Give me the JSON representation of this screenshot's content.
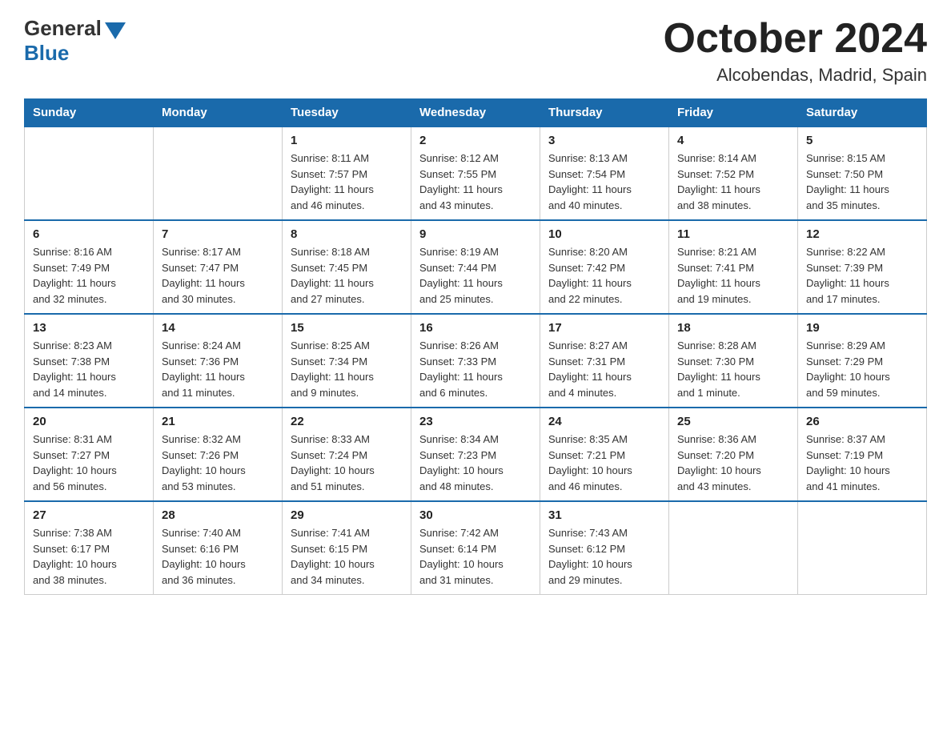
{
  "header": {
    "logo": {
      "general": "General",
      "blue": "Blue"
    },
    "title": "October 2024",
    "location": "Alcobendas, Madrid, Spain"
  },
  "columns": [
    "Sunday",
    "Monday",
    "Tuesday",
    "Wednesday",
    "Thursday",
    "Friday",
    "Saturday"
  ],
  "weeks": [
    [
      {
        "day": "",
        "info": ""
      },
      {
        "day": "",
        "info": ""
      },
      {
        "day": "1",
        "info": "Sunrise: 8:11 AM\nSunset: 7:57 PM\nDaylight: 11 hours\nand 46 minutes."
      },
      {
        "day": "2",
        "info": "Sunrise: 8:12 AM\nSunset: 7:55 PM\nDaylight: 11 hours\nand 43 minutes."
      },
      {
        "day": "3",
        "info": "Sunrise: 8:13 AM\nSunset: 7:54 PM\nDaylight: 11 hours\nand 40 minutes."
      },
      {
        "day": "4",
        "info": "Sunrise: 8:14 AM\nSunset: 7:52 PM\nDaylight: 11 hours\nand 38 minutes."
      },
      {
        "day": "5",
        "info": "Sunrise: 8:15 AM\nSunset: 7:50 PM\nDaylight: 11 hours\nand 35 minutes."
      }
    ],
    [
      {
        "day": "6",
        "info": "Sunrise: 8:16 AM\nSunset: 7:49 PM\nDaylight: 11 hours\nand 32 minutes."
      },
      {
        "day": "7",
        "info": "Sunrise: 8:17 AM\nSunset: 7:47 PM\nDaylight: 11 hours\nand 30 minutes."
      },
      {
        "day": "8",
        "info": "Sunrise: 8:18 AM\nSunset: 7:45 PM\nDaylight: 11 hours\nand 27 minutes."
      },
      {
        "day": "9",
        "info": "Sunrise: 8:19 AM\nSunset: 7:44 PM\nDaylight: 11 hours\nand 25 minutes."
      },
      {
        "day": "10",
        "info": "Sunrise: 8:20 AM\nSunset: 7:42 PM\nDaylight: 11 hours\nand 22 minutes."
      },
      {
        "day": "11",
        "info": "Sunrise: 8:21 AM\nSunset: 7:41 PM\nDaylight: 11 hours\nand 19 minutes."
      },
      {
        "day": "12",
        "info": "Sunrise: 8:22 AM\nSunset: 7:39 PM\nDaylight: 11 hours\nand 17 minutes."
      }
    ],
    [
      {
        "day": "13",
        "info": "Sunrise: 8:23 AM\nSunset: 7:38 PM\nDaylight: 11 hours\nand 14 minutes."
      },
      {
        "day": "14",
        "info": "Sunrise: 8:24 AM\nSunset: 7:36 PM\nDaylight: 11 hours\nand 11 minutes."
      },
      {
        "day": "15",
        "info": "Sunrise: 8:25 AM\nSunset: 7:34 PM\nDaylight: 11 hours\nand 9 minutes."
      },
      {
        "day": "16",
        "info": "Sunrise: 8:26 AM\nSunset: 7:33 PM\nDaylight: 11 hours\nand 6 minutes."
      },
      {
        "day": "17",
        "info": "Sunrise: 8:27 AM\nSunset: 7:31 PM\nDaylight: 11 hours\nand 4 minutes."
      },
      {
        "day": "18",
        "info": "Sunrise: 8:28 AM\nSunset: 7:30 PM\nDaylight: 11 hours\nand 1 minute."
      },
      {
        "day": "19",
        "info": "Sunrise: 8:29 AM\nSunset: 7:29 PM\nDaylight: 10 hours\nand 59 minutes."
      }
    ],
    [
      {
        "day": "20",
        "info": "Sunrise: 8:31 AM\nSunset: 7:27 PM\nDaylight: 10 hours\nand 56 minutes."
      },
      {
        "day": "21",
        "info": "Sunrise: 8:32 AM\nSunset: 7:26 PM\nDaylight: 10 hours\nand 53 minutes."
      },
      {
        "day": "22",
        "info": "Sunrise: 8:33 AM\nSunset: 7:24 PM\nDaylight: 10 hours\nand 51 minutes."
      },
      {
        "day": "23",
        "info": "Sunrise: 8:34 AM\nSunset: 7:23 PM\nDaylight: 10 hours\nand 48 minutes."
      },
      {
        "day": "24",
        "info": "Sunrise: 8:35 AM\nSunset: 7:21 PM\nDaylight: 10 hours\nand 46 minutes."
      },
      {
        "day": "25",
        "info": "Sunrise: 8:36 AM\nSunset: 7:20 PM\nDaylight: 10 hours\nand 43 minutes."
      },
      {
        "day": "26",
        "info": "Sunrise: 8:37 AM\nSunset: 7:19 PM\nDaylight: 10 hours\nand 41 minutes."
      }
    ],
    [
      {
        "day": "27",
        "info": "Sunrise: 7:38 AM\nSunset: 6:17 PM\nDaylight: 10 hours\nand 38 minutes."
      },
      {
        "day": "28",
        "info": "Sunrise: 7:40 AM\nSunset: 6:16 PM\nDaylight: 10 hours\nand 36 minutes."
      },
      {
        "day": "29",
        "info": "Sunrise: 7:41 AM\nSunset: 6:15 PM\nDaylight: 10 hours\nand 34 minutes."
      },
      {
        "day": "30",
        "info": "Sunrise: 7:42 AM\nSunset: 6:14 PM\nDaylight: 10 hours\nand 31 minutes."
      },
      {
        "day": "31",
        "info": "Sunrise: 7:43 AM\nSunset: 6:12 PM\nDaylight: 10 hours\nand 29 minutes."
      },
      {
        "day": "",
        "info": ""
      },
      {
        "day": "",
        "info": ""
      }
    ]
  ]
}
